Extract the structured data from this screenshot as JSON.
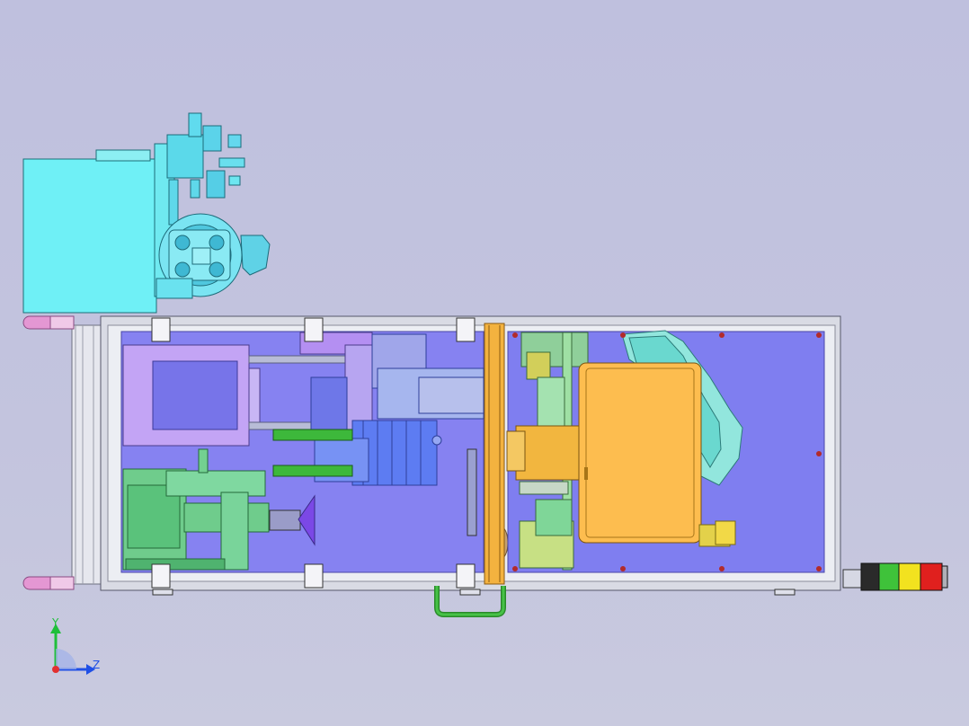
{
  "window": {
    "title": ""
  },
  "viewport": {
    "background": "#c2c3de"
  },
  "colors": {
    "enclosure": "#6ff0f6",
    "frame": "#dfe1e8",
    "panel_left": "#8682f1",
    "panel_right": "#7f7ef0",
    "orange_plate": "#f3b23f",
    "monitor": "#fdbd4f",
    "green_block": "#6fcc8c",
    "light_purple": "#c3a4f5",
    "cylinder": "#6a7ef8",
    "handle": "#3fbf3f",
    "lamp_red": "#e0201e",
    "lamp_yellow": "#f2e21f",
    "lamp_green": "#3fc23a",
    "caster": "#e497d3"
  },
  "signal_tower": {
    "lamps": [
      "black",
      "green",
      "yellow",
      "red"
    ]
  },
  "axis_triad": {
    "y_label": "Y",
    "z_label": "Z"
  }
}
